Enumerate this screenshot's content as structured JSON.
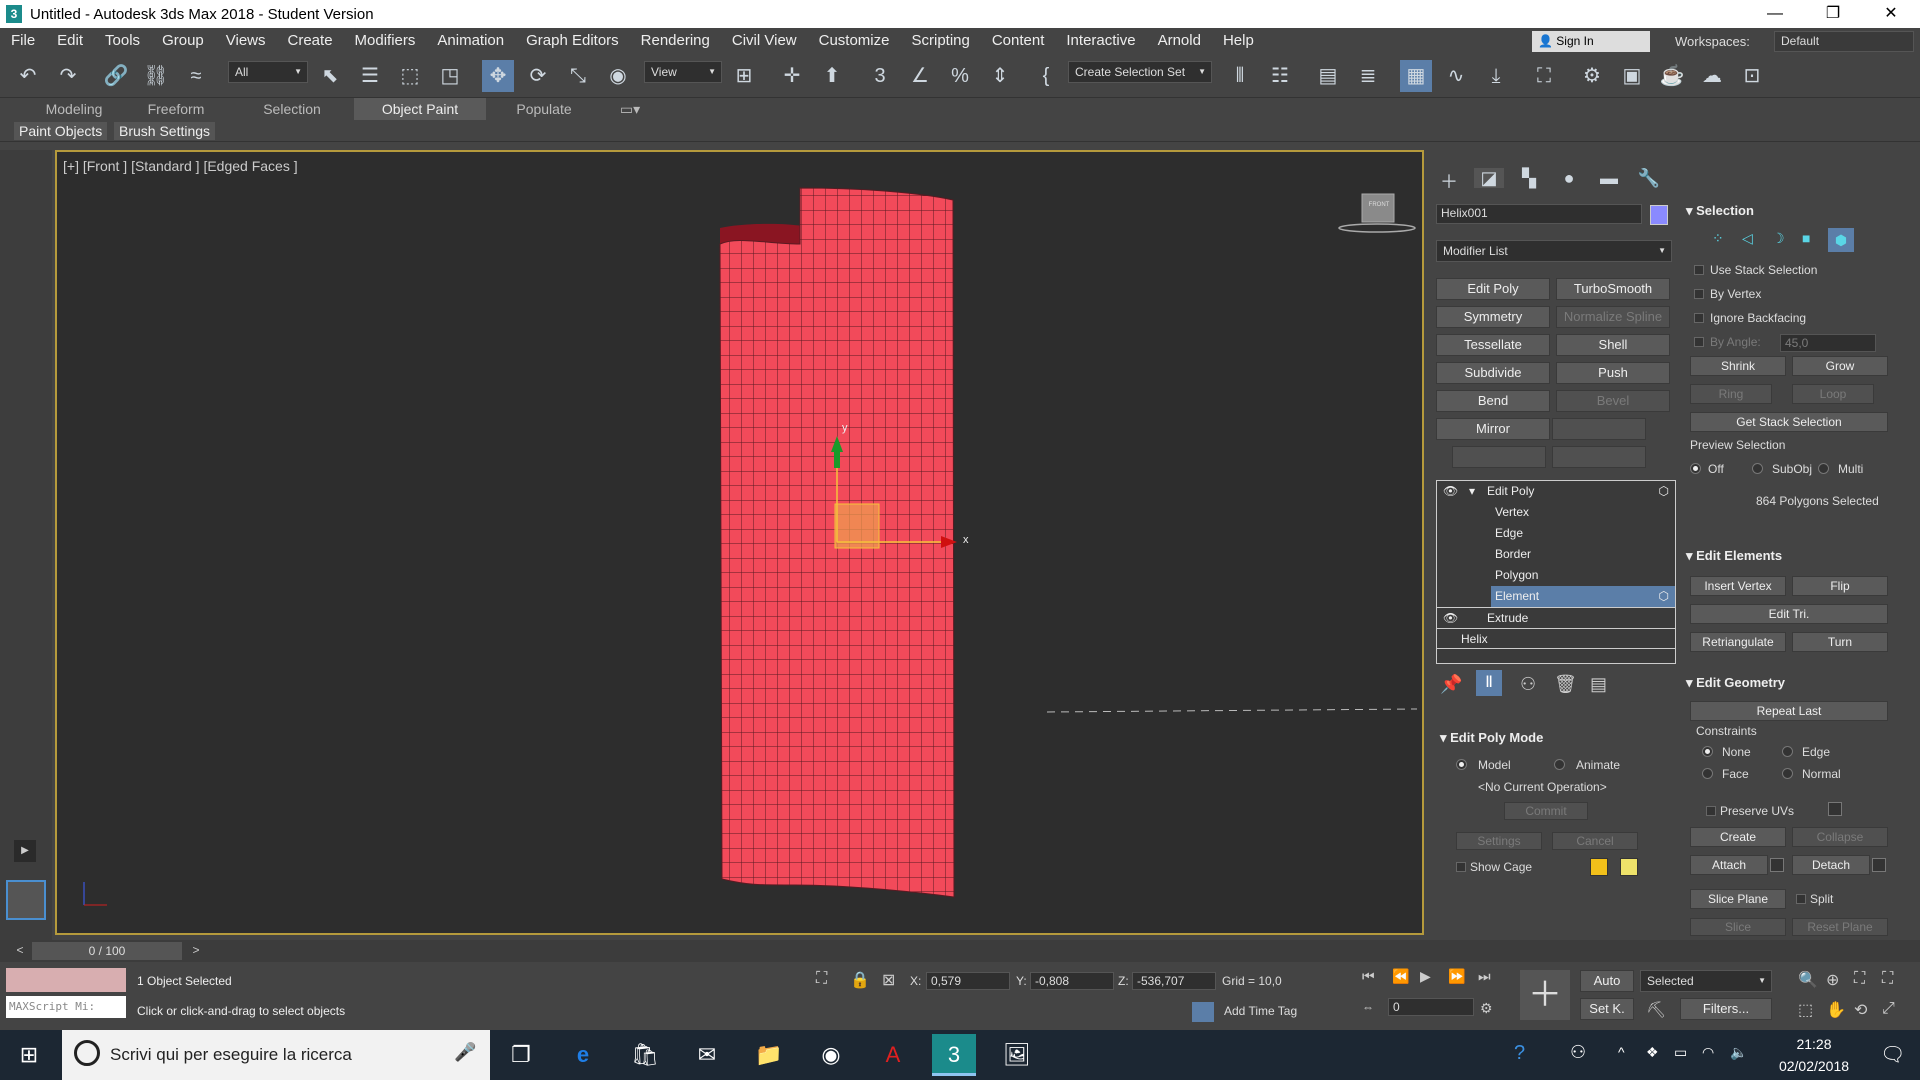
{
  "window": {
    "title": "Untitled - Autodesk 3ds Max 2018 - Student Version",
    "app_icon": "3",
    "minimize": "—",
    "maximize": "❐",
    "close": "✕"
  },
  "menu": [
    "File",
    "Edit",
    "Tools",
    "Group",
    "Views",
    "Create",
    "Modifiers",
    "Animation",
    "Graph Editors",
    "Rendering",
    "Civil View",
    "Customize",
    "Scripting",
    "Content",
    "Interactive",
    "Arnold",
    "Help"
  ],
  "signin": "Sign In",
  "workspaces": {
    "label": "Workspaces:",
    "value": "Default"
  },
  "toolbar": {
    "filter_value": "All",
    "refcoord_value": "View",
    "selection_set": "Create Selection Set"
  },
  "ribbon": {
    "tabs": [
      "Modeling",
      "Freeform",
      "Selection",
      "Object Paint",
      "Populate"
    ],
    "active_tab": "Object Paint",
    "sub": [
      "Paint Objects",
      "Brush Settings"
    ]
  },
  "viewport": {
    "label": "[+] [Front ] [Standard ] [Edged Faces ]",
    "gizmo_x": "x",
    "gizmo_y": "y",
    "viewcube": "FRONT",
    "mesh_color": "#f24a5a"
  },
  "command_panel": {
    "object_name": "Helix001",
    "object_color": "#8a8aff",
    "modifier_list": "Modifier List",
    "modifier_buttons": [
      {
        "label": "Edit Poly",
        "enabled": true
      },
      {
        "label": "TurboSmooth",
        "enabled": true
      },
      {
        "label": "Symmetry",
        "enabled": true
      },
      {
        "label": "Normalize Spline",
        "enabled": false
      },
      {
        "label": "Tessellate",
        "enabled": true
      },
      {
        "label": "Shell",
        "enabled": true
      },
      {
        "label": "Subdivide",
        "enabled": true
      },
      {
        "label": "Push",
        "enabled": true
      },
      {
        "label": "Bend",
        "enabled": true
      },
      {
        "label": "Bevel",
        "enabled": false
      },
      {
        "label": "Mirror",
        "enabled": true
      },
      {
        "label": "",
        "enabled": false
      }
    ],
    "stack": [
      {
        "label": "Edit Poly",
        "level": 0,
        "selected": false
      },
      {
        "label": "Vertex",
        "level": 1,
        "selected": false
      },
      {
        "label": "Edge",
        "level": 1,
        "selected": false
      },
      {
        "label": "Border",
        "level": 1,
        "selected": false
      },
      {
        "label": "Polygon",
        "level": 1,
        "selected": false
      },
      {
        "label": "Element",
        "level": 1,
        "selected": true
      },
      {
        "label": "Extrude",
        "level": 0,
        "selected": false
      },
      {
        "label": "Helix",
        "level": -1,
        "selected": false
      }
    ],
    "edit_poly_mode": {
      "title": "Edit Poly Mode",
      "model": "Model",
      "animate": "Animate",
      "current_op": "<No Current Operation>",
      "commit": "Commit",
      "settings": "Settings",
      "cancel": "Cancel",
      "show_cage": "Show Cage"
    },
    "selection": {
      "title": "Selection",
      "use_stack": "Use Stack Selection",
      "by_vertex": "By Vertex",
      "ignore_backfacing": "Ignore Backfacing",
      "by_angle": "By Angle:",
      "angle_value": "45,0",
      "shrink": "Shrink",
      "grow": "Grow",
      "ring": "Ring",
      "loop": "Loop",
      "get_stack": "Get Stack Selection",
      "preview": "Preview Selection",
      "off": "Off",
      "subobj": "SubObj",
      "multi": "Multi",
      "count": "864 Polygons Selected"
    },
    "edit_elements": {
      "title": "Edit Elements",
      "insert_vertex": "Insert Vertex",
      "flip": "Flip",
      "edit_tri": "Edit Tri.",
      "retriangulate": "Retriangulate",
      "turn": "Turn"
    },
    "edit_geometry": {
      "title": "Edit Geometry",
      "repeat_last": "Repeat Last",
      "constraints": "Constraints",
      "none": "None",
      "edge": "Edge",
      "face": "Face",
      "normal": "Normal",
      "preserve_uvs": "Preserve UVs",
      "create": "Create",
      "collapse": "Collapse",
      "attach": "Attach",
      "detach": "Detach",
      "slice_plane": "Slice Plane",
      "split": "Split",
      "slice": "Slice",
      "reset_plane": "Reset Plane"
    }
  },
  "timeline": {
    "frame": "0 / 100",
    "prev": "<",
    "next": ">"
  },
  "status": {
    "maxscript": "MAXScript Mi:",
    "objects_selected": "1 Object Selected",
    "prompt": "Click or click-and-drag to select objects",
    "x_label": "X:",
    "x_value": "0,579",
    "y_label": "Y:",
    "y_value": "-0,808",
    "z_label": "Z:",
    "z_value": "-536,707",
    "grid": "Grid = 10,0",
    "add_time_tag": "Add Time Tag",
    "auto": "Auto",
    "set_key": "Set K.",
    "key_filter": "Selected",
    "filters": "Filters...",
    "frame_field": "0"
  },
  "taskbar": {
    "search_placeholder": "Scrivi qui per eseguire la ricerca",
    "time": "21:28",
    "date": "02/02/2018"
  }
}
